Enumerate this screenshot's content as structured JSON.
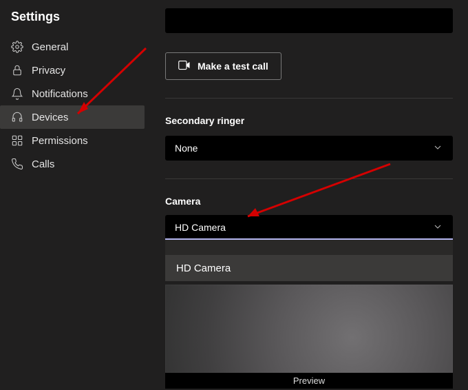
{
  "title": "Settings",
  "sidebar": {
    "items": [
      {
        "label": "General"
      },
      {
        "label": "Privacy"
      },
      {
        "label": "Notifications"
      },
      {
        "label": "Devices"
      },
      {
        "label": "Permissions"
      },
      {
        "label": "Calls"
      }
    ]
  },
  "main": {
    "test_call_label": "Make a test call",
    "secondary_ringer_label": "Secondary ringer",
    "secondary_ringer_value": "None",
    "camera_label": "Camera",
    "camera_value": "HD Camera",
    "camera_options": [
      "HD Camera"
    ],
    "preview_label": "Preview"
  }
}
